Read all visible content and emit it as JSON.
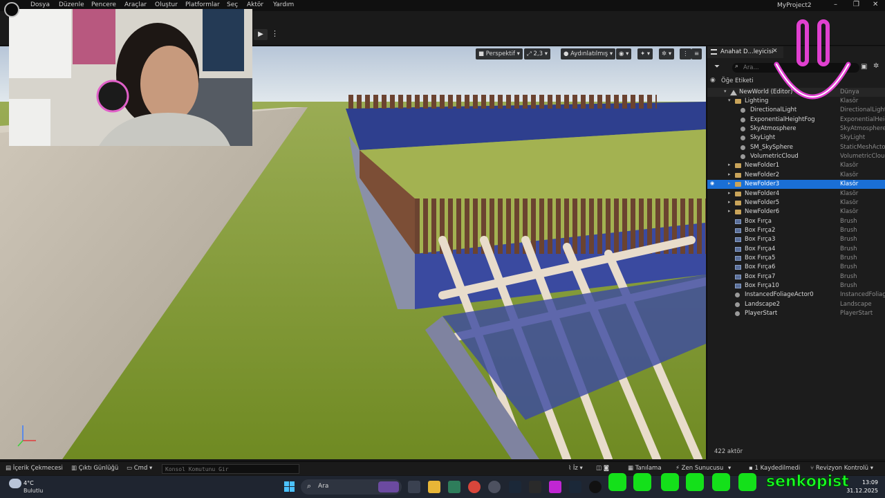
{
  "menubar": {
    "items": [
      "Dosya",
      "Düzenle",
      "Pencere",
      "Araçlar",
      "Oluştur",
      "Platformlar",
      "Seç",
      "Aktör",
      "Yardım"
    ],
    "project_name": "MyProject2"
  },
  "viewport": {
    "perspective_label": "Perspektif",
    "scalability_label": "2,3",
    "lighting_label": "Aydınlatılmış"
  },
  "outliner": {
    "tab_title": "Anahat D...leyicisi",
    "search_placeholder": "Ara...",
    "header_label": "Öğe Etiketi",
    "root": {
      "name": "NewWorld (Editor)",
      "type": "Dünya"
    },
    "rows": [
      {
        "name": "Lighting",
        "type": "Klasör",
        "icon": "folder-icon",
        "depth": 1,
        "expanded": true
      },
      {
        "name": "DirectionalLight",
        "type": "DirectionalLight",
        "icon": "sun-icon",
        "depth": 2
      },
      {
        "name": "ExponentialHeightFog",
        "type": "ExponentialHeightFog",
        "icon": "fog-icon",
        "depth": 2
      },
      {
        "name": "SkyAtmosphere",
        "type": "SkyAtmosphere",
        "icon": "sky-icon",
        "depth": 2
      },
      {
        "name": "SkyLight",
        "type": "SkyLight",
        "icon": "skylight-icon",
        "depth": 2
      },
      {
        "name": "SM_SkySphere",
        "type": "StaticMeshActor",
        "icon": "mesh-icon",
        "depth": 2
      },
      {
        "name": "VolumetricCloud",
        "type": "VolumetricCloud",
        "icon": "cloud-icon",
        "depth": 2
      },
      {
        "name": "NewFolder1",
        "type": "Klasör",
        "icon": "folder-icon",
        "depth": 1
      },
      {
        "name": "NewFolder2",
        "type": "Klasör",
        "icon": "folder-icon",
        "depth": 1
      },
      {
        "name": "NewFolder3",
        "type": "Klasör",
        "icon": "folder-icon",
        "depth": 1,
        "selected": true
      },
      {
        "name": "NewFolder4",
        "type": "Klasör",
        "icon": "folder-icon",
        "depth": 1
      },
      {
        "name": "NewFolder5",
        "type": "Klasör",
        "icon": "folder-icon",
        "depth": 1
      },
      {
        "name": "NewFolder6",
        "type": "Klasör",
        "icon": "folder-icon",
        "depth": 1
      },
      {
        "name": "Box Fırça",
        "type": "Brush",
        "icon": "brush-icon",
        "depth": 1
      },
      {
        "name": "Box Fırça2",
        "type": "Brush",
        "icon": "brush-icon",
        "depth": 1
      },
      {
        "name": "Box Fırça3",
        "type": "Brush",
        "icon": "brush-icon",
        "depth": 1
      },
      {
        "name": "Box Fırça4",
        "type": "Brush",
        "icon": "brush-icon",
        "depth": 1
      },
      {
        "name": "Box Fırça5",
        "type": "Brush",
        "icon": "brush-icon",
        "depth": 1
      },
      {
        "name": "Box Fırça6",
        "type": "Brush",
        "icon": "brush-icon",
        "depth": 1
      },
      {
        "name": "Box Fırça7",
        "type": "Brush",
        "icon": "brush-icon",
        "depth": 1
      },
      {
        "name": "Box Fırça10",
        "type": "Brush",
        "icon": "brush-icon",
        "depth": 1
      },
      {
        "name": "InstancedFoliageActor0",
        "type": "InstancedFoliage",
        "icon": "foliage-icon",
        "depth": 1
      },
      {
        "name": "Landscape2",
        "type": "Landscape",
        "icon": "landscape-icon",
        "depth": 1
      },
      {
        "name": "PlayerStart",
        "type": "PlayerStart",
        "icon": "playerstart-icon",
        "depth": 1
      }
    ],
    "actor_count": "422 aktör"
  },
  "statusbar": {
    "content_drawer": "İçerik Çekmecesi",
    "output_log": "Çıktı Günlüğü",
    "cmd": "Cmd",
    "console_placeholder": "Konsol Komutunu Gir",
    "trace": "İz",
    "diagnostics": "Tanılama",
    "zen_server": "Zen Sunucusu",
    "unsaved": "1 Kaydedilmedi",
    "revision_control": "Revizyon Kontrolü"
  },
  "taskbar": {
    "temperature": "4°C",
    "weather": "Bulutlu",
    "search_label": "Ara",
    "time": "13:09",
    "date": "31.12.2025"
  },
  "overlay": {
    "handle": "senkopist",
    "accent": "#19ff25",
    "smiley_color": "#e040d0"
  }
}
